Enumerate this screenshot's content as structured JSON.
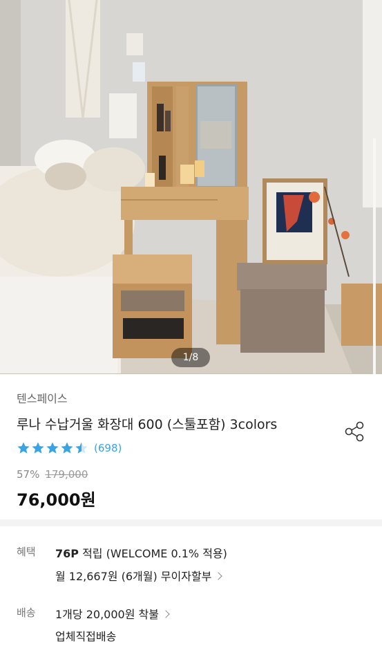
{
  "hero": {
    "image_description": "wooden vanity table with mirror, stool and storage ottoman in a bedroom",
    "counter": "1/8"
  },
  "product": {
    "brand": "텐스페이스",
    "title": "루나 수납거울 화장대 600 (스툴포함) 3colors",
    "rating": 4.5,
    "review_count": "(698)",
    "discount": "57%",
    "original_price": "179,000",
    "price": "76,000원"
  },
  "benefit": {
    "label": "혜택",
    "points": "76P",
    "points_text": " 적립 (WELCOME 0.1% 적용)",
    "installment": "월 12,667원 (6개월) 무이자할부"
  },
  "shipping": {
    "label": "배송",
    "fee": "1개당 20,000원 착불",
    "method": "업체직접배송"
  },
  "colors": {
    "star": "#3aa3e3",
    "review_link": "#3aa3e3"
  },
  "icons": {
    "share": "share-icon",
    "star": "star-icon",
    "chevron": "chevron-right-icon"
  }
}
